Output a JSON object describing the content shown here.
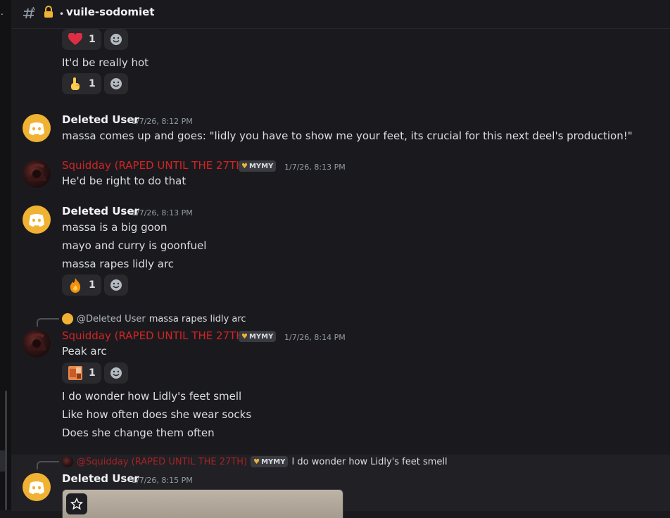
{
  "channel": {
    "name": "vuile-sodomiet"
  },
  "rail": {
    "mark": "."
  },
  "colors": {
    "role_red": "#d22424",
    "discord_orange": "#f0b232"
  },
  "messages": [
    {
      "reactions": [
        {
          "emoji": "heart",
          "count": "1"
        }
      ]
    },
    {
      "text": "It'd be really hot",
      "reactions": [
        {
          "emoji": "pointing-up-hand",
          "count": "1"
        }
      ]
    },
    {
      "author": "Deleted User",
      "time": "1/7/26, 8:12 PM",
      "text": "massa comes up and goes: \"lidly you have to show me your feet, its crucial for this next deel's production!\""
    },
    {
      "author": "Squidday (RAPED UNTIL THE 27TH)",
      "tag": "MYMY",
      "time": "1/7/26, 8:13 PM",
      "text": "He'd be right to do that"
    },
    {
      "author": "Deleted User",
      "time": "1/7/26, 8:13 PM",
      "lines": [
        "massa is a big goon",
        "mayo and curry is goonfuel",
        "massa rapes lidly arc"
      ],
      "reactions": [
        {
          "emoji": "fire",
          "count": "1"
        }
      ]
    },
    {
      "reply_to": {
        "author": "@Deleted User",
        "snippet": "massa rapes lidly arc"
      },
      "author": "Squidday (RAPED UNTIL THE 27TH)",
      "tag": "MYMY",
      "time": "1/7/26, 8:14 PM",
      "text": "Peak arc",
      "reactions": [
        {
          "emoji": "custom-image",
          "count": "1"
        }
      ],
      "lines": [
        "I do wonder how Lidly's feet smell",
        "Like how often does she wear socks",
        "Does she change them often"
      ]
    },
    {
      "reply_to": {
        "author": "@Squidday (RAPED UNTIL THE 27TH)",
        "tag": "MYMY",
        "snippet": "I do wonder how Lidly's feet smell"
      },
      "author": "Deleted User",
      "time": "1/7/26, 8:15 PM"
    }
  ]
}
